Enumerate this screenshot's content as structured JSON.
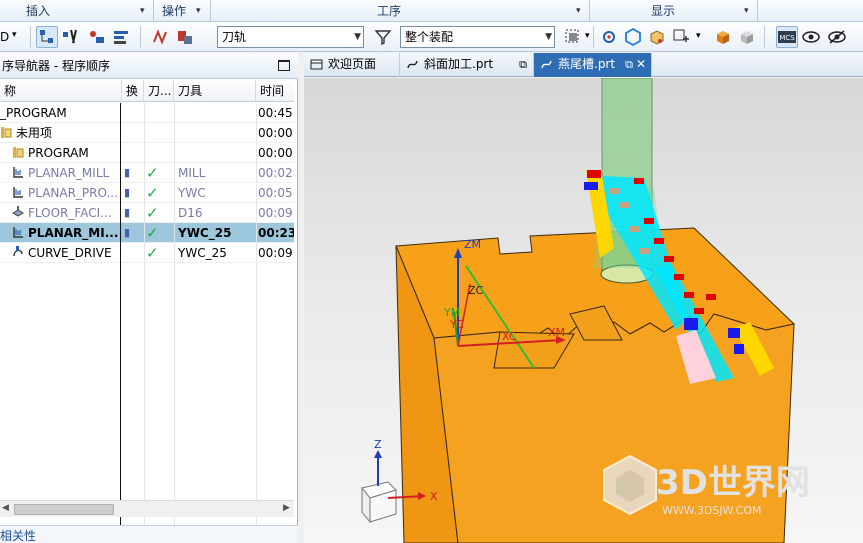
{
  "ribbon": {
    "groups": [
      {
        "label": "插入"
      },
      {
        "label": "操作"
      },
      {
        "label": "工序"
      },
      {
        "label": "显示"
      }
    ]
  },
  "toolbar": {
    "left_combo_fragment": "D",
    "filter_combo_value": "刀轨",
    "assembly_combo_value": "整个装配"
  },
  "navigator": {
    "title": "序导航器 - 程序顺序",
    "columns": [
      "称",
      "换",
      "刀...",
      "刀具",
      "时间"
    ],
    "rows": [
      {
        "name": "_PROGRAM",
        "change": "",
        "check": "",
        "tool": "",
        "time": "00:45:",
        "style": "normal",
        "icon": "none"
      },
      {
        "name": "未用项",
        "change": "",
        "check": "",
        "tool": "",
        "time": "00:00:",
        "style": "normal",
        "icon": "folder"
      },
      {
        "name": "PROGRAM",
        "change": "",
        "check": "",
        "tool": "",
        "time": "00:00:",
        "style": "normal",
        "icon": "folder"
      },
      {
        "name": "PLANAR_MILL",
        "change": "▮",
        "check": "✓",
        "tool": "MILL",
        "time": "00:02:",
        "style": "gray",
        "icon": "planar"
      },
      {
        "name": "PLANAR_PRO...",
        "change": "▮",
        "check": "✓",
        "tool": "YWC",
        "time": "00:05:",
        "style": "gray",
        "icon": "planar"
      },
      {
        "name": "FLOOR_FACI...",
        "change": "▮",
        "check": "✓",
        "tool": "D16",
        "time": "00:09:",
        "style": "gray",
        "icon": "floor"
      },
      {
        "name": "PLANAR_MI...",
        "change": "▮",
        "check": "✓",
        "tool": "YWC_25",
        "time": "00:23:",
        "style": "selected",
        "icon": "planar"
      },
      {
        "name": "CURVE_DRIVE",
        "change": "",
        "check": "✓",
        "tool": "YWC_25",
        "time": "00:09:",
        "style": "normal",
        "icon": "curve"
      }
    ],
    "dependencies_label": "相关性"
  },
  "tabs": [
    {
      "label": "欢迎页面",
      "active": false
    },
    {
      "label": "斜面加工.prt",
      "active": false
    },
    {
      "label": "燕尾槽.prt",
      "active": true
    }
  ],
  "viewport": {
    "axis_labels": {
      "zm": "ZM",
      "zc": "ZC",
      "ym": "YM",
      "yc": "YC",
      "xc": "XC",
      "xm": "XM",
      "z": "Z",
      "x": "X"
    },
    "watermark_main": "3D世界网",
    "watermark_url": "WWW.3DSJW.COM",
    "part_color": "#f7a11a",
    "tool_color": "#8ecf8e"
  },
  "icons": {
    "ribbon_dropdown": "chevron-down-icon",
    "filter": "funnel-icon",
    "maximize": "maximize-icon",
    "tab_welcome": "home-icon",
    "tab_part": "part-file-icon",
    "tab_close": "close-icon",
    "check": "check-icon"
  }
}
